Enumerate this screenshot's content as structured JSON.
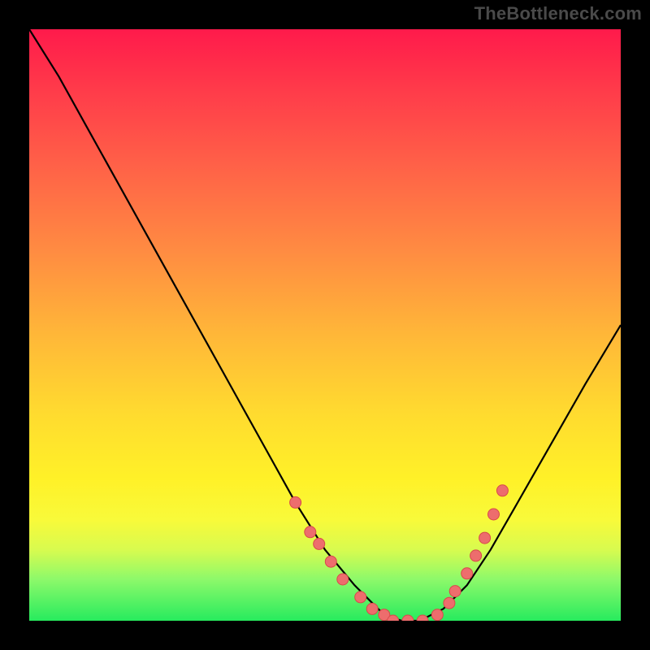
{
  "watermark": "TheBottleneck.com",
  "chart_data": {
    "type": "line",
    "title": "",
    "xlabel": "",
    "ylabel": "",
    "ylim": [
      0,
      100
    ],
    "x": [
      0.0,
      0.05,
      0.1,
      0.15,
      0.2,
      0.25,
      0.3,
      0.35,
      0.4,
      0.45,
      0.5,
      0.55,
      0.58,
      0.6,
      0.63,
      0.66,
      0.7,
      0.74,
      0.78,
      0.82,
      0.86,
      0.9,
      0.94,
      1.0
    ],
    "values": [
      100,
      92,
      83,
      74,
      65,
      56,
      47,
      38,
      29,
      20,
      12,
      6,
      3,
      1,
      0,
      0,
      2,
      6,
      12,
      19,
      26,
      33,
      40,
      50
    ],
    "note": "x is normalized horizontal position across the plot, values are percent of vertical span from bottom (0 = bottom, 100 = top)",
    "marker_points": [
      {
        "x": 0.45,
        "y": 20
      },
      {
        "x": 0.475,
        "y": 15
      },
      {
        "x": 0.49,
        "y": 13
      },
      {
        "x": 0.51,
        "y": 10
      },
      {
        "x": 0.53,
        "y": 7
      },
      {
        "x": 0.56,
        "y": 4
      },
      {
        "x": 0.58,
        "y": 2
      },
      {
        "x": 0.6,
        "y": 1
      },
      {
        "x": 0.615,
        "y": 0
      },
      {
        "x": 0.64,
        "y": 0
      },
      {
        "x": 0.665,
        "y": 0
      },
      {
        "x": 0.69,
        "y": 1
      },
      {
        "x": 0.71,
        "y": 3
      },
      {
        "x": 0.72,
        "y": 5
      },
      {
        "x": 0.74,
        "y": 8
      },
      {
        "x": 0.755,
        "y": 11
      },
      {
        "x": 0.77,
        "y": 14
      },
      {
        "x": 0.785,
        "y": 18
      },
      {
        "x": 0.8,
        "y": 22
      }
    ],
    "colors": {
      "curve": "#000000",
      "marker_fill": "#ed6d6d",
      "marker_stroke": "#d84a4a"
    }
  }
}
